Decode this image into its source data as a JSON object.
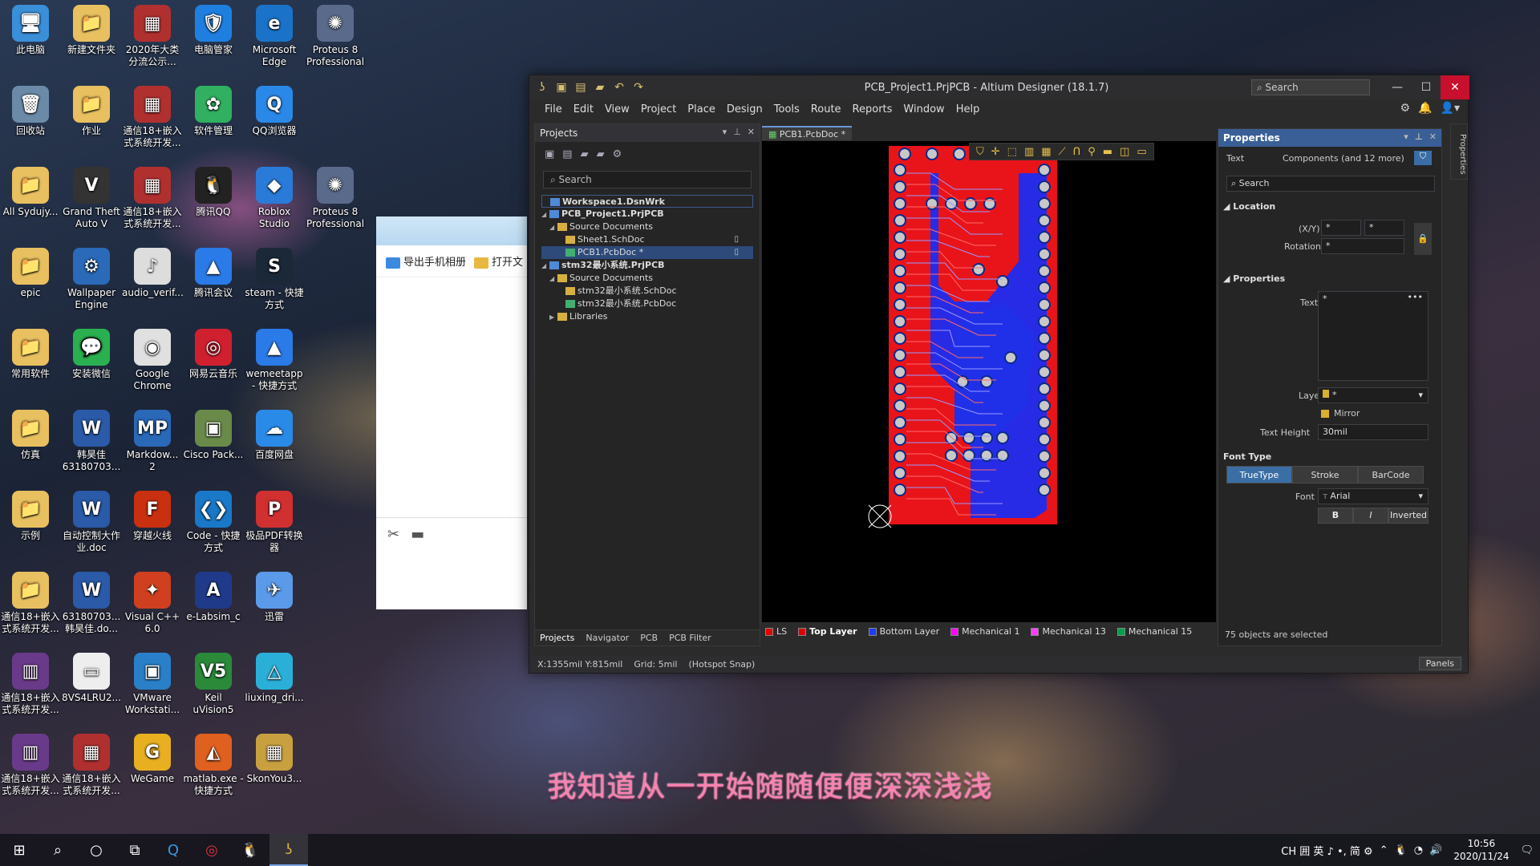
{
  "desktop": {
    "icons": [
      {
        "label": "此电脑",
        "x": 0,
        "y": 0,
        "color": "#3a8fd8",
        "glyph": "🖥"
      },
      {
        "label": "新建文件夹",
        "x": 1,
        "y": 0,
        "color": "#e8c060",
        "glyph": "📁"
      },
      {
        "label": "2020年大类分流公示...",
        "x": 2,
        "y": 0,
        "color": "#b03030",
        "glyph": "▦"
      },
      {
        "label": "电脑管家",
        "x": 3,
        "y": 0,
        "color": "#1e7fe0",
        "glyph": "🛡"
      },
      {
        "label": "Microsoft Edge",
        "x": 4,
        "y": 0,
        "color": "#1a73c8",
        "glyph": "e"
      },
      {
        "label": "Proteus 8 Professional",
        "x": 5,
        "y": 0,
        "color": "#5a6a8a",
        "glyph": "✺"
      },
      {
        "label": "回收站",
        "x": 0,
        "y": 1,
        "color": "#6a8aa8",
        "glyph": "🗑"
      },
      {
        "label": "作业",
        "x": 1,
        "y": 1,
        "color": "#e8c060",
        "glyph": "📁"
      },
      {
        "label": "通信18+嵌入式系统开发...",
        "x": 2,
        "y": 1,
        "color": "#b03030",
        "glyph": "▦"
      },
      {
        "label": "软件管理",
        "x": 3,
        "y": 1,
        "color": "#30b060",
        "glyph": "✿"
      },
      {
        "label": "QQ浏览器",
        "x": 4,
        "y": 1,
        "color": "#2a88e8",
        "glyph": "Q"
      },
      {
        "label": "All Sydujy...",
        "x": 0,
        "y": 2,
        "color": "#e8c060",
        "glyph": "📁"
      },
      {
        "label": "Grand Theft Auto V",
        "x": 1,
        "y": 2,
        "color": "#333",
        "glyph": "V"
      },
      {
        "label": "通信18+嵌入式系统开发...",
        "x": 2,
        "y": 2,
        "color": "#b03030",
        "glyph": "▦"
      },
      {
        "label": "腾讯QQ",
        "x": 3,
        "y": 2,
        "color": "#222",
        "glyph": "🐧"
      },
      {
        "label": "Roblox Studio",
        "x": 4,
        "y": 2,
        "color": "#2a7ad8",
        "glyph": "◆"
      },
      {
        "label": "Proteus 8 Professional",
        "x": 5,
        "y": 2,
        "color": "#5a6a8a",
        "glyph": "✺"
      },
      {
        "label": "epic",
        "x": 0,
        "y": 3,
        "color": "#e8c060",
        "glyph": "📁"
      },
      {
        "label": "Wallpaper Engine",
        "x": 1,
        "y": 3,
        "color": "#2a6ab8",
        "glyph": "⚙"
      },
      {
        "label": "audio_verif...",
        "x": 2,
        "y": 3,
        "color": "#ddd",
        "glyph": "♪"
      },
      {
        "label": "腾讯会议",
        "x": 3,
        "y": 3,
        "color": "#2a7ae8",
        "glyph": "▲"
      },
      {
        "label": "steam - 快捷方式",
        "x": 4,
        "y": 3,
        "color": "#1b2838",
        "glyph": "S"
      },
      {
        "label": "常用软件",
        "x": 0,
        "y": 4,
        "color": "#e8c060",
        "glyph": "📁"
      },
      {
        "label": "安装微信",
        "x": 1,
        "y": 4,
        "color": "#2ab050",
        "glyph": "💬"
      },
      {
        "label": "Google Chrome",
        "x": 2,
        "y": 4,
        "color": "#e0e0e0",
        "glyph": "◉"
      },
      {
        "label": "网易云音乐",
        "x": 3,
        "y": 4,
        "color": "#d02030",
        "glyph": "◎"
      },
      {
        "label": "wemeetapp - 快捷方式",
        "x": 4,
        "y": 4,
        "color": "#2a7ae8",
        "glyph": "▲"
      },
      {
        "label": "仿真",
        "x": 0,
        "y": 5,
        "color": "#e8c060",
        "glyph": "📁"
      },
      {
        "label": "韩昊佳63180703...",
        "x": 1,
        "y": 5,
        "color": "#2a5aa8",
        "glyph": "W"
      },
      {
        "label": "Markdow... 2",
        "x": 2,
        "y": 5,
        "color": "#2a68b8",
        "glyph": "MP"
      },
      {
        "label": "Cisco Pack...",
        "x": 3,
        "y": 5,
        "color": "#6a8a4a",
        "glyph": "▣"
      },
      {
        "label": "百度网盘",
        "x": 4,
        "y": 5,
        "color": "#2a8ae8",
        "glyph": "☁"
      },
      {
        "label": "示例",
        "x": 0,
        "y": 6,
        "color": "#e8c060",
        "glyph": "📁"
      },
      {
        "label": "自动控制大作业.doc",
        "x": 1,
        "y": 6,
        "color": "#2a5aa8",
        "glyph": "W"
      },
      {
        "label": "穿越火线",
        "x": 2,
        "y": 6,
        "color": "#c83010",
        "glyph": "F"
      },
      {
        "label": "Code - 快捷方式",
        "x": 3,
        "y": 6,
        "color": "#1a78c8",
        "glyph": "❮❯"
      },
      {
        "label": "极品PDF转换器",
        "x": 4,
        "y": 6,
        "color": "#d03030",
        "glyph": "P"
      },
      {
        "label": "通信18+嵌入式系统开发...",
        "x": 0,
        "y": 7,
        "color": "#e8c060",
        "glyph": "📁"
      },
      {
        "label": "63180703... 韩昊佳.do...",
        "x": 1,
        "y": 7,
        "color": "#2a5aa8",
        "glyph": "W"
      },
      {
        "label": "Visual C++ 6.0",
        "x": 2,
        "y": 7,
        "color": "#d04020",
        "glyph": "✦"
      },
      {
        "label": "e-Labsim_c",
        "x": 3,
        "y": 7,
        "color": "#203a8a",
        "glyph": "A"
      },
      {
        "label": "迅雷",
        "x": 4,
        "y": 7,
        "color": "#5a9ae8",
        "glyph": "✈"
      },
      {
        "label": "通信18+嵌入式系统开发...",
        "x": 0,
        "y": 8,
        "color": "#6a3a8a",
        "glyph": "▥"
      },
      {
        "label": "8VS4LRU2...",
        "x": 1,
        "y": 8,
        "color": "#eee",
        "glyph": "▭"
      },
      {
        "label": "VMware Workstati...",
        "x": 2,
        "y": 8,
        "color": "#2a80c8",
        "glyph": "▣"
      },
      {
        "label": "Keil uVision5",
        "x": 3,
        "y": 8,
        "color": "#2a8a3a",
        "glyph": "V5"
      },
      {
        "label": "liuxing_dri...",
        "x": 4,
        "y": 8,
        "color": "#2ab0d8",
        "glyph": "△"
      },
      {
        "label": "通信18+嵌入式系统开发...",
        "x": 0,
        "y": 9,
        "color": "#6a3a8a",
        "glyph": "▥"
      },
      {
        "label": "通信18+嵌入式系统开发...",
        "x": 1,
        "y": 9,
        "color": "#b03030",
        "glyph": "▦"
      },
      {
        "label": "WeGame",
        "x": 2,
        "y": 9,
        "color": "#e8b020",
        "glyph": "G"
      },
      {
        "label": "matlab.exe - 快捷方式",
        "x": 3,
        "y": 9,
        "color": "#e06020",
        "glyph": "◭"
      },
      {
        "label": "SkonYou3...",
        "x": 4,
        "y": 9,
        "color": "#c8a040",
        "glyph": "▦"
      }
    ]
  },
  "bg_window": {
    "export_label": "导出手机相册",
    "open_label": "打开文"
  },
  "altium": {
    "title": "PCB_Project1.PrjPCB - Altium Designer (18.1.7)",
    "search_placeholder": "Search",
    "menu": [
      "File",
      "Edit",
      "View",
      "Project",
      "Place",
      "Design",
      "Tools",
      "Route",
      "Reports",
      "Window",
      "Help"
    ],
    "projects_panel": {
      "title": "Projects",
      "search_placeholder": "Search",
      "tree": [
        {
          "label": "Workspace1.DsnWrk",
          "indent": 0,
          "type": "workspace"
        },
        {
          "label": "PCB_Project1.PrjPCB",
          "indent": 0,
          "type": "project",
          "bold": true,
          "sel": true
        },
        {
          "label": "Source Documents",
          "indent": 1,
          "type": "folder"
        },
        {
          "label": "Sheet1.SchDoc",
          "indent": 2,
          "type": "sch",
          "mark": "▯"
        },
        {
          "label": "PCB1.PcbDoc *",
          "indent": 2,
          "type": "pcb",
          "selected": true,
          "mark": "▯"
        },
        {
          "label": "stm32最小系统.PrjPCB",
          "indent": 0,
          "type": "project",
          "bold": true
        },
        {
          "label": "Source Documents",
          "indent": 1,
          "type": "folder"
        },
        {
          "label": "stm32最小系统.SchDoc",
          "indent": 2,
          "type": "sch"
        },
        {
          "label": "stm32最小系统.PcbDoc",
          "indent": 2,
          "type": "pcb"
        },
        {
          "label": "Libraries",
          "indent": 1,
          "type": "folder",
          "collapsed": true
        }
      ],
      "tabs": [
        "Projects",
        "Navigator",
        "PCB",
        "PCB Filter"
      ]
    },
    "doc_tab": "PCB1.PcbDoc *",
    "layers": [
      {
        "name": "LS",
        "color": "#e00000"
      },
      {
        "name": "Top Layer",
        "color": "#e00000",
        "active": true
      },
      {
        "name": "Bottom Layer",
        "color": "#1e3cff"
      },
      {
        "name": "Mechanical 1",
        "color": "#ff00ff"
      },
      {
        "name": "Mechanical 13",
        "color": "#ff40ff"
      },
      {
        "name": "Mechanical 15",
        "color": "#00a050"
      }
    ],
    "properties": {
      "title": "Properties",
      "filter_label": "Text",
      "filter_value": "Components (and 12 more)",
      "search_placeholder": "Search",
      "location_head": "Location",
      "xy_label": "(X/Y)",
      "x_value": "*",
      "y_value": "*",
      "rotation_label": "Rotation",
      "rotation_value": "*",
      "properties_head": "Properties",
      "text_label": "Text",
      "text_value": "*",
      "layer_label": "Layer",
      "layer_value": "*",
      "mirror_label": "Mirror",
      "text_height_label": "Text Height",
      "text_height_value": "30mil",
      "font_type_head": "Font Type",
      "font_types": [
        "TrueType",
        "Stroke",
        "BarCode"
      ],
      "font_type_selected": "TrueType",
      "font_label": "Font",
      "font_value": "Arial",
      "bold_label": "B",
      "italic_label": "I",
      "inverted_label": "Inverted",
      "selection_status": "75 objects are selected",
      "side_tab": "Properties"
    },
    "status": {
      "coords": "X:1355mil Y:815mil",
      "grid": "Grid: 5mil",
      "snap": "(Hotspot Snap)",
      "panels_button": "Panels"
    }
  },
  "subtitle": "我知道从一开始随随便便深深浅浅",
  "taskbar": {
    "tray_text": "CH 囲 英 ♪ •, 简 ⚙",
    "time": "10:56",
    "date": "2020/11/24"
  }
}
